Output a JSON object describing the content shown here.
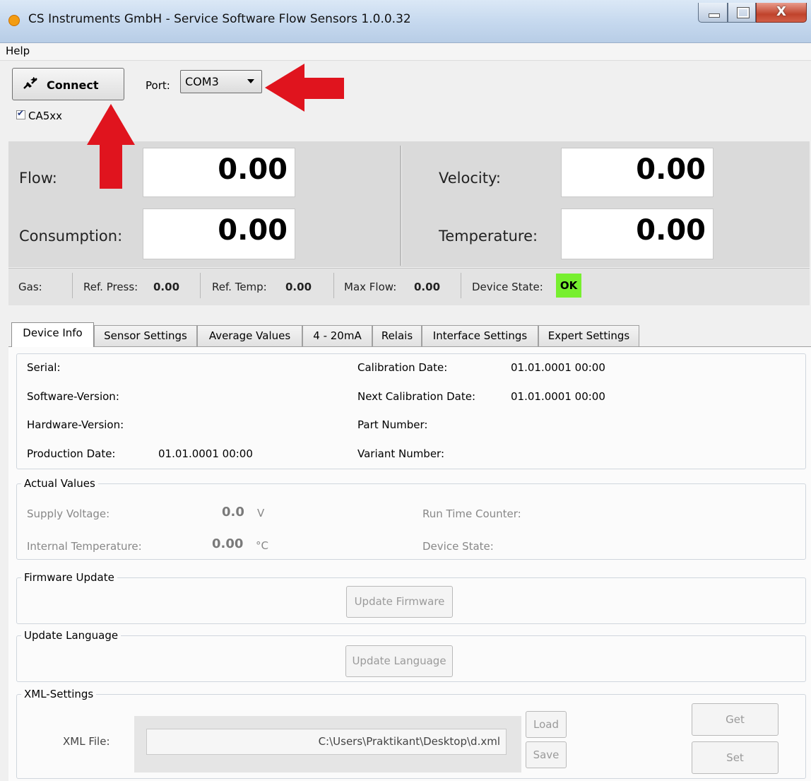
{
  "window": {
    "title": "CS Instruments GmbH - Service Software Flow Sensors  1.0.0.32",
    "close_glyph": "X"
  },
  "menu": {
    "help": "Help"
  },
  "toolbar": {
    "connect_label": "Connect",
    "port_label": "Port:",
    "port_value": "COM3",
    "ca5xx_label": "CA5xx",
    "ca5xx_checked": true
  },
  "measurements": {
    "flow_label": "Flow:",
    "flow_value": "0.00",
    "consumption_label": "Consumption:",
    "consumption_value": "0.00",
    "velocity_label": "Velocity:",
    "velocity_value": "0.00",
    "temperature_label": "Temperature:",
    "temperature_value": "0.00"
  },
  "status": {
    "gas_label": "Gas:",
    "ref_press_label": "Ref. Press:",
    "ref_press_value": "0.00",
    "ref_temp_label": "Ref. Temp:",
    "ref_temp_value": "0.00",
    "max_flow_label": "Max Flow:",
    "max_flow_value": "0.00",
    "device_state_label": "Device State:",
    "device_state_value": "OK",
    "device_state_color": "#77ef2f"
  },
  "tabs": [
    "Device Info",
    "Sensor Settings",
    "Average Values",
    "4 - 20mA",
    "Relais",
    "Interface Settings",
    "Expert Settings"
  ],
  "active_tab": "Device Info",
  "device_info": {
    "serial_label": "Serial:",
    "software_version_label": "Software-Version:",
    "hardware_version_label": "Hardware-Version:",
    "production_date_label": "Production Date:",
    "production_date_value": "01.01.0001 00:00",
    "calibration_date_label": "Calibration Date:",
    "calibration_date_value": "01.01.0001 00:00",
    "next_calibration_date_label": "Next Calibration Date:",
    "next_calibration_date_value": "01.01.0001 00:00",
    "part_number_label": "Part Number:",
    "variant_number_label": "Variant Number:"
  },
  "actual_values": {
    "title": "Actual Values",
    "supply_voltage_label": "Supply Voltage:",
    "supply_voltage_value": "0.0",
    "supply_voltage_unit": "V",
    "internal_temperature_label": "Internal Temperature:",
    "internal_temperature_value": "0.00",
    "internal_temperature_unit": "°C",
    "run_time_counter_label": "Run Time Counter:",
    "device_state_label": "Device State:"
  },
  "firmware_update": {
    "title": "Firmware Update",
    "button": "Update Firmware"
  },
  "update_language": {
    "title": "Update Language",
    "button": "Update Language"
  },
  "xml_settings": {
    "title": "XML-Settings",
    "file_label": "XML File:",
    "file_path": "C:\\Users\\Praktikant\\Desktop\\d.xml",
    "load_button": "Load",
    "save_button": "Save",
    "get_button": "Get",
    "set_button": "Set"
  },
  "annotation_color": "#e0141e"
}
